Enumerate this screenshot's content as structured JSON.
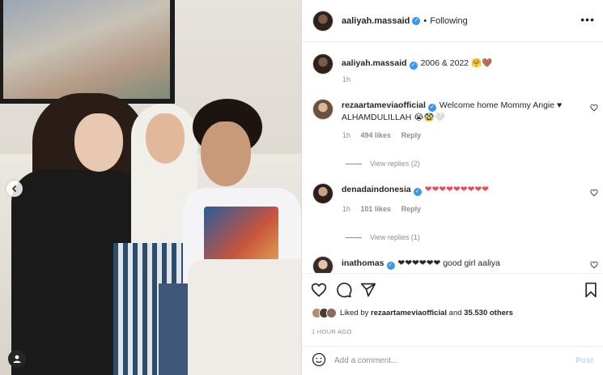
{
  "post": {
    "username": "aaliyah.massaid",
    "follow_status": "Following",
    "separator": "•",
    "more": "•••"
  },
  "caption": {
    "username": "aaliyah.massaid",
    "text": "2006 & 2022 🤗🤎",
    "time": "1h"
  },
  "comments": [
    {
      "username": "rezaartameviaofficial",
      "text": "Welcome home Mommy Angie ♥ ALHAMDULILLAH 😭🥸🤍",
      "time": "1h",
      "likes": "494 likes",
      "reply": "Reply",
      "view_replies": "View replies (2)"
    },
    {
      "username": "denadaindonesia",
      "text": "❤❤❤❤❤❤❤❤❤",
      "time": "1h",
      "likes": "101 likes",
      "reply": "Reply",
      "view_replies": "View replies (1)"
    },
    {
      "username": "inathomas",
      "text": "❤❤❤❤❤❤ good girl aaliya"
    }
  ],
  "likes": {
    "prefix": "Liked by",
    "user": "rezaartameviaofficial",
    "conj": "and",
    "others": "35.530 others"
  },
  "timestamp": "1 HOUR AGO",
  "comment_box": {
    "placeholder": "Add a comment...",
    "post_label": "Post"
  },
  "colors": {
    "verified": "#3897f0",
    "heart_red": "#ed4956",
    "post_disabled": "#b2dffc",
    "muted": "#8e8e8e"
  }
}
